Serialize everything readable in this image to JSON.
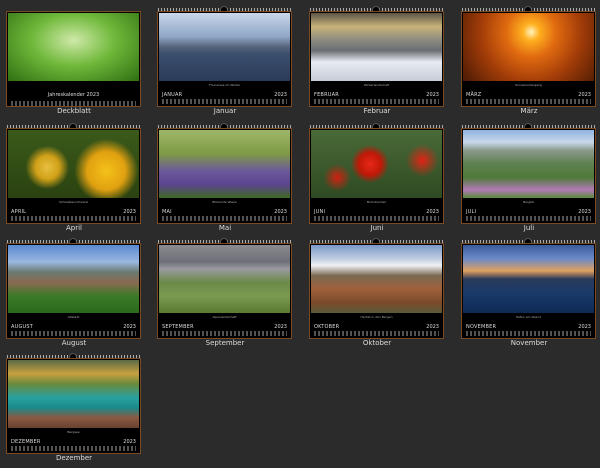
{
  "gallery": {
    "cover": {
      "title": "Jahreskalender 2023",
      "label": "Deckblatt"
    },
    "months": [
      {
        "name": "JANUAR",
        "label": "Januar",
        "year": "2023",
        "caption": "Thunersee im Winter"
      },
      {
        "name": "FEBRUAR",
        "label": "Februar",
        "year": "2023",
        "caption": "Winterlandschaft"
      },
      {
        "name": "MÄRZ",
        "label": "März",
        "year": "2023",
        "caption": "Sonnenuntergang"
      },
      {
        "name": "APRIL",
        "label": "April",
        "year": "2023",
        "caption": "Schwalbenschwanz"
      },
      {
        "name": "MAI",
        "label": "Mai",
        "year": "2023",
        "caption": "Blühende Wiese"
      },
      {
        "name": "JUNI",
        "label": "Juni",
        "year": "2023",
        "caption": "Mohnblumen"
      },
      {
        "name": "JULI",
        "label": "Juli",
        "year": "2023",
        "caption": "Bergtal"
      },
      {
        "name": "AUGUST",
        "label": "August",
        "year": "2023",
        "caption": "Altstadt"
      },
      {
        "name": "SEPTEMBER",
        "label": "September",
        "year": "2023",
        "caption": "Alpenlandschaft"
      },
      {
        "name": "OKTOBER",
        "label": "Oktober",
        "year": "2023",
        "caption": "Herbst in den Bergen"
      },
      {
        "name": "NOVEMBER",
        "label": "November",
        "year": "2023",
        "caption": "Hafen am Abend"
      },
      {
        "name": "DEZEMBER",
        "label": "Dezember",
        "year": "2023",
        "caption": "Bergsee"
      }
    ]
  },
  "colors": {
    "background": "#2b2b2b",
    "frame": "#7a4a22"
  }
}
